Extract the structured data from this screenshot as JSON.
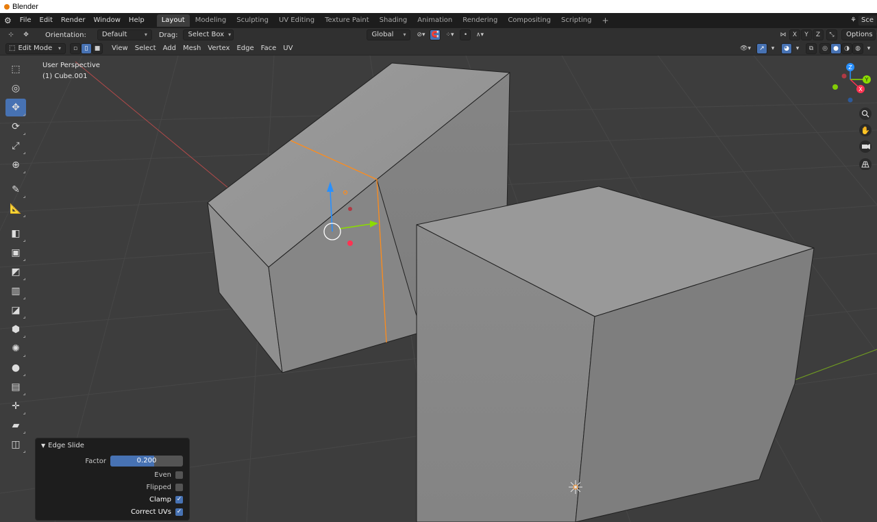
{
  "window": {
    "title": "Blender"
  },
  "menus": [
    "File",
    "Edit",
    "Render",
    "Window",
    "Help"
  ],
  "workspaces": [
    "Layout",
    "Modeling",
    "Sculpting",
    "UV Editing",
    "Texture Paint",
    "Shading",
    "Animation",
    "Rendering",
    "Compositing",
    "Scripting"
  ],
  "active_workspace": "Layout",
  "scene_label": "Sce",
  "tool_header": {
    "orientation_label": "Orientation:",
    "orientation_value": "Default",
    "drag_label": "Drag:",
    "drag_value": "Select Box",
    "transform_orientation": "Global",
    "options_label": "Options",
    "axes": [
      "X",
      "Y",
      "Z"
    ]
  },
  "editor_header": {
    "mode": "Edit Mode",
    "menus": [
      "View",
      "Select",
      "Add",
      "Mesh",
      "Vertex",
      "Edge",
      "Face",
      "UV"
    ]
  },
  "viewport": {
    "view_name": "User Perspective",
    "object_name": "(1) Cube.001"
  },
  "gizmo": {
    "z": "Z",
    "y": "Y",
    "x": "X"
  },
  "tools": [
    {
      "name": "select-box-tool",
      "glyph": "⬚"
    },
    {
      "name": "cursor-tool",
      "glyph": "◎"
    },
    {
      "name": "move-tool",
      "glyph": "✥"
    },
    {
      "name": "rotate-tool",
      "glyph": "⟳"
    },
    {
      "name": "scale-tool",
      "glyph": "⤢"
    },
    {
      "name": "transform-tool",
      "glyph": "⊕"
    },
    {
      "name": "annotate-tool",
      "glyph": "✎"
    },
    {
      "name": "measure-tool",
      "glyph": "📐"
    },
    {
      "name": "extrude-region-tool",
      "glyph": "◧"
    },
    {
      "name": "inset-faces-tool",
      "glyph": "▣"
    },
    {
      "name": "bevel-tool",
      "glyph": "◩"
    },
    {
      "name": "loop-cut-tool",
      "glyph": "▥"
    },
    {
      "name": "knife-tool",
      "glyph": "◪"
    },
    {
      "name": "poly-build-tool",
      "glyph": "⬢"
    },
    {
      "name": "spin-tool",
      "glyph": "✺"
    },
    {
      "name": "smooth-tool",
      "glyph": "●"
    },
    {
      "name": "edge-slide-tool",
      "glyph": "▤"
    },
    {
      "name": "shrink-fatten-tool",
      "glyph": "✛"
    },
    {
      "name": "shear-tool",
      "glyph": "▰"
    },
    {
      "name": "rip-region-tool",
      "glyph": "◫"
    }
  ],
  "operator_panel": {
    "title": "Edge Slide",
    "factor_label": "Factor",
    "factor_value": "0.200",
    "factor_fraction": 0.6,
    "even_label": "Even",
    "even_checked": false,
    "flipped_label": "Flipped",
    "flipped_checked": false,
    "clamp_label": "Clamp",
    "clamp_checked": true,
    "correct_uvs_label": "Correct UVs",
    "correct_uvs_checked": true
  },
  "colors": {
    "accent": "#4772b3",
    "selection": "#ff8c1a",
    "mesh_light": "#9a9a9a",
    "mesh_mid": "#8a8a8a",
    "mesh_dark": "#7b7b7b",
    "grid_bg": "#3d3d3d",
    "x_axis": "#ff3352",
    "y_axis": "#8bdc00",
    "z_axis": "#2890ff"
  }
}
